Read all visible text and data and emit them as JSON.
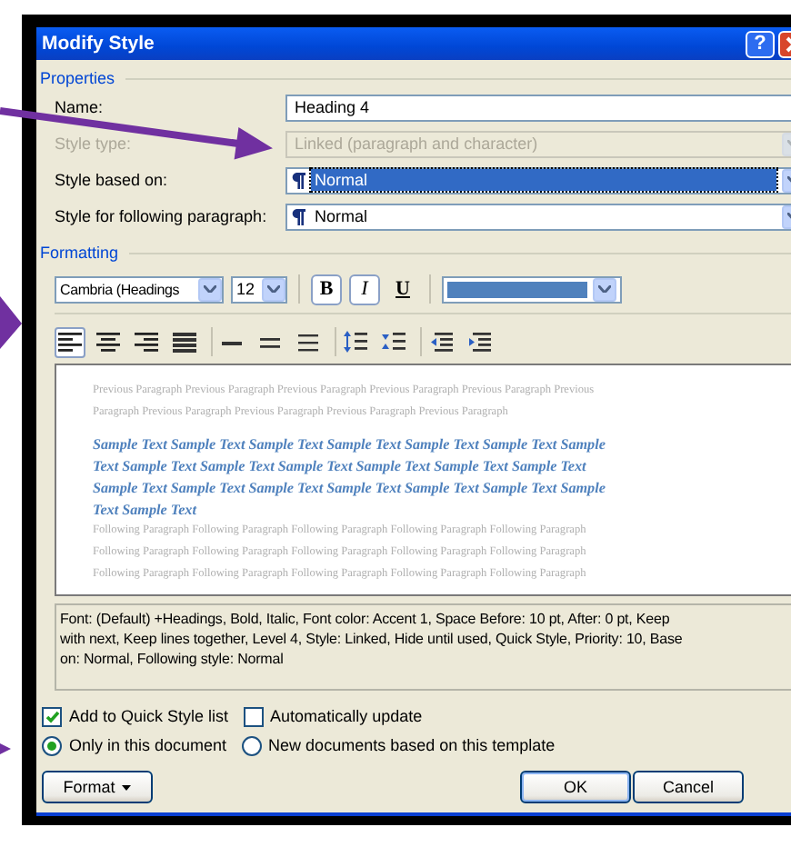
{
  "window": {
    "title": "Modify Style",
    "title_buttons": [
      {
        "kind": "help",
        "label": "?"
      },
      {
        "kind": "close"
      }
    ]
  },
  "properties": {
    "heading": "Properties",
    "fields": [
      {
        "label": "Name:",
        "kind": "text",
        "value": "Heading 4",
        "disabled": false,
        "selected": false
      },
      {
        "label": "Style type:",
        "kind": "combo",
        "value": "Linked (paragraph and character)",
        "disabled": true,
        "selected": false
      },
      {
        "label": "Style based on:",
        "kind": "style-combo",
        "value": "Normal",
        "disabled": false,
        "selected": true
      },
      {
        "label": "Style for following paragraph:",
        "kind": "style-combo",
        "value": "Normal",
        "disabled": false,
        "selected": false
      }
    ]
  },
  "formatting": {
    "heading": "Formatting",
    "font": "Cambria (Headings",
    "size": "12",
    "toggles": [
      {
        "label": "B",
        "kind": "bold",
        "on": true
      },
      {
        "label": "I",
        "kind": "italic",
        "on": true
      },
      {
        "label": "U",
        "kind": "underline",
        "on": false
      }
    ],
    "font_color_picker": {
      "color": "#4f81bd"
    },
    "paragraph_buttons": [
      {
        "kind": "align-left",
        "selected": true
      },
      {
        "kind": "align-center",
        "selected": false
      },
      {
        "kind": "align-right",
        "selected": false
      },
      {
        "kind": "justify",
        "selected": false
      },
      {
        "kind": "single-spacing",
        "selected": false
      },
      {
        "kind": "one-half-spacing",
        "selected": false
      },
      {
        "kind": "double-spacing",
        "selected": false
      },
      {
        "kind": "space-increase",
        "selected": false
      },
      {
        "kind": "space-decrease",
        "selected": false
      },
      {
        "kind": "indent-decrease",
        "selected": false
      },
      {
        "kind": "indent-increase",
        "selected": false
      }
    ]
  },
  "preview": {
    "previous": [
      "Previous Paragraph Previous Paragraph Previous Paragraph Previous Paragraph Previous Paragraph Previous",
      "Paragraph Previous Paragraph Previous Paragraph Previous Paragraph Previous Paragraph"
    ],
    "sample": [
      "Sample Text Sample Text Sample Text Sample Text Sample Text Sample Text Sample",
      "Text Sample Text Sample Text Sample Text Sample Text Sample Text Sample Text",
      "Sample Text Sample Text Sample Text Sample Text Sample Text Sample Text Sample",
      "Text Sample Text"
    ],
    "following": [
      "Following Paragraph Following Paragraph Following Paragraph Following Paragraph Following Paragraph",
      "Following Paragraph Following Paragraph Following Paragraph Following Paragraph Following Paragraph",
      "Following Paragraph Following Paragraph Following Paragraph Following Paragraph Following Paragraph"
    ]
  },
  "description": [
    "Font: (Default) +Headings, Bold, Italic, Font color: Accent 1, Space Before:  10 pt, After:  0 pt, Keep",
    "with next, Keep lines together, Level 4, Style: Linked, Hide until used, Quick Style, Priority: 10, Base",
    "on: Normal, Following style: Normal"
  ],
  "checkboxes": [
    {
      "label": "Add to Quick Style list",
      "checked": true
    },
    {
      "label": "Automatically update",
      "checked": false
    }
  ],
  "radios": [
    {
      "label": "Only in this document",
      "selected": true
    },
    {
      "label": "New documents based on this template",
      "selected": false
    }
  ],
  "buttons": [
    {
      "label": "Format",
      "kind": "menu"
    },
    {
      "label": "OK",
      "kind": "default"
    },
    {
      "label": "Cancel",
      "kind": "plain"
    }
  ]
}
